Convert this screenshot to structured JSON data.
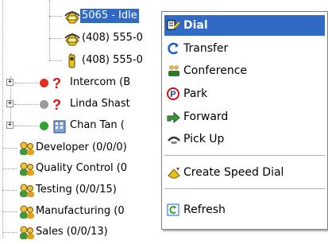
{
  "tree": {
    "phones": [
      {
        "label": "5065 - Idle",
        "selected": true,
        "icon": "phone-icon"
      },
      {
        "label": "(408) 555-0",
        "icon": "phone-icon"
      },
      {
        "label": "(408) 555-0",
        "icon": "cellphone-icon"
      }
    ],
    "contacts": [
      {
        "label": "Intercom (B",
        "status": "red",
        "icon": "question-icon"
      },
      {
        "label": "Linda Shast",
        "status": "gray",
        "icon": "question-icon"
      },
      {
        "label": "Chan Tan (",
        "status": "green",
        "icon": "building-icon"
      }
    ],
    "groups": [
      {
        "label": "Developer  (0/0/0)",
        "icon": "group-icon"
      },
      {
        "label": "Quality Control  (0",
        "icon": "group-icon"
      },
      {
        "label": "Testing  (0/0/15)",
        "icon": "group-icon"
      },
      {
        "label": "Manufacturing  (0",
        "icon": "group-icon"
      },
      {
        "label": "Sales  (0/0/13)",
        "icon": "group-icon"
      }
    ]
  },
  "context_menu": {
    "items": [
      {
        "label": "Dial",
        "icon": "dial-icon",
        "active": true
      },
      {
        "label": "Transfer",
        "icon": "transfer-icon"
      },
      {
        "label": "Conference",
        "icon": "conference-icon"
      },
      {
        "label": "Park",
        "icon": "park-icon"
      },
      {
        "label": "Forward",
        "icon": "forward-icon"
      },
      {
        "label": "Pick Up",
        "icon": "pickup-icon"
      },
      {
        "label": "Create Speed Dial",
        "icon": "speed-dial-icon"
      },
      {
        "label": "Refresh",
        "icon": "refresh-icon"
      }
    ]
  },
  "colors": {
    "selection": "#316ac5",
    "status_red": "#e03020",
    "status_gray": "#9a9a9a",
    "status_green": "#2fa52f"
  }
}
